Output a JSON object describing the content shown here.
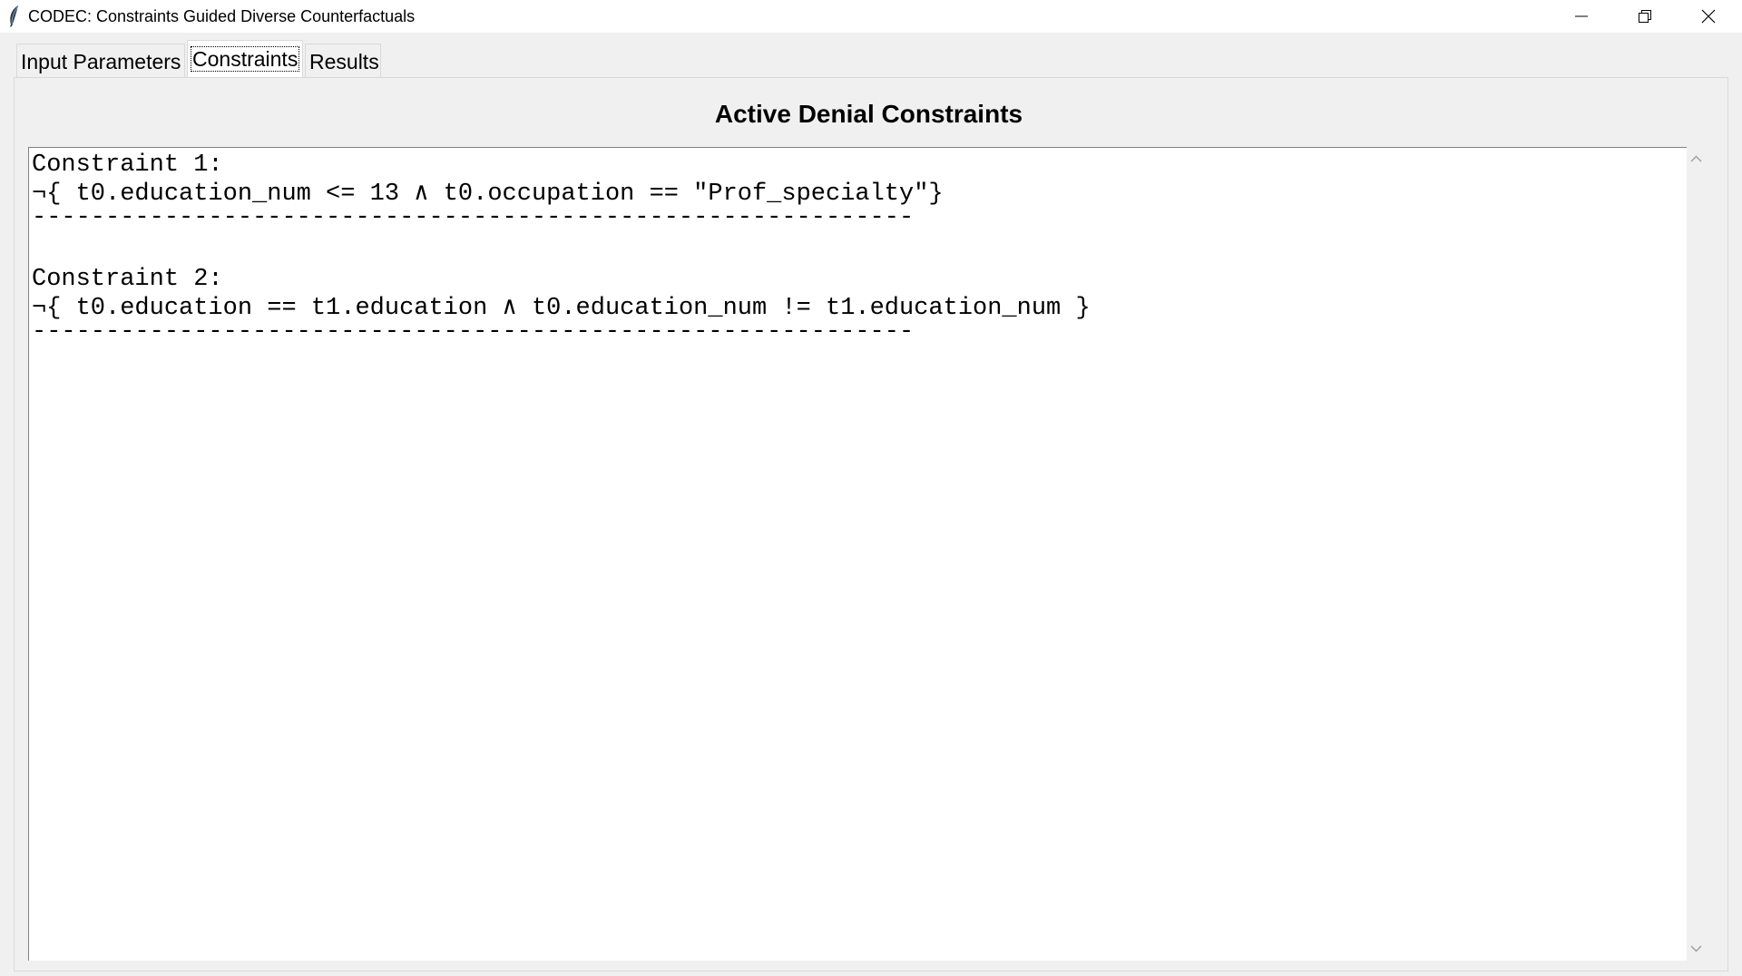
{
  "window": {
    "title": "CODEC: Constraints Guided Diverse Counterfactuals"
  },
  "tabs": [
    {
      "label": "Input Parameters",
      "active": false
    },
    {
      "label": "Constraints",
      "active": true
    },
    {
      "label": "Results",
      "active": false
    }
  ],
  "constraints_panel": {
    "heading": "Active Denial Constraints",
    "lines": [
      "Constraint 1:",
      "¬{ t0.education_num <= 13 ∧ t0.occupation == \"Prof_specialty\"}",
      "------------------------------------------------------------",
      "",
      "Constraint 2:",
      "¬{ t0.education == t1.education ∧ t0.education_num != t1.education_num }",
      "------------------------------------------------------------"
    ]
  },
  "icons": {
    "app": "feather-icon",
    "minimize": "minimize-icon",
    "maximize": "restore-icon",
    "close": "close-icon",
    "scroll_up": "chevron-up-icon",
    "scroll_down": "chevron-down-icon"
  }
}
